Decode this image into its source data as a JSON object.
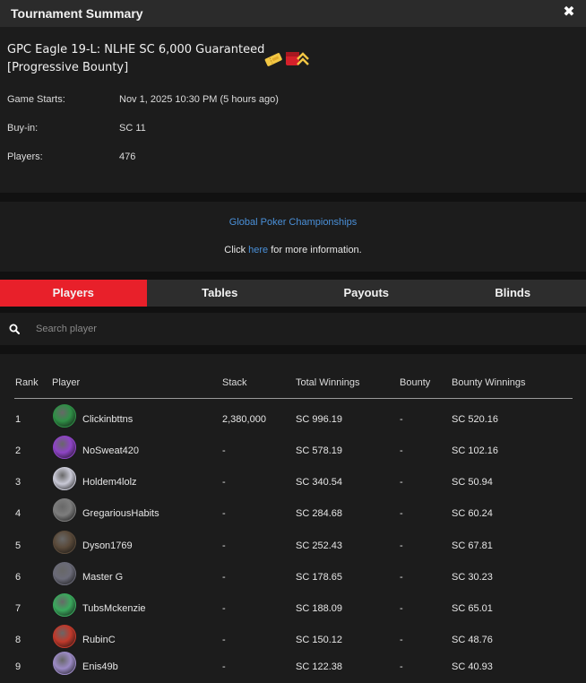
{
  "window": {
    "title": "Tournament Summary",
    "close_icon": "close-icon"
  },
  "tournament": {
    "name": "GPC Eagle 19-L: NLHE SC 6,000 Guaranteed [Progressive Bounty]",
    "icons": [
      "ticket-icon",
      "progressive-bounty-icon"
    ],
    "details": [
      {
        "label": "Game Starts:",
        "value": "Nov 1, 2025 10:30 PM (5 hours ago)"
      },
      {
        "label": "Buy-in:",
        "value": "SC 11"
      },
      {
        "label": "Players:",
        "value": "476"
      }
    ]
  },
  "promo": {
    "series_link": "Global Poker Championships",
    "prefix": "Click",
    "link": "here",
    "suffix": "for more information."
  },
  "tabs": [
    {
      "label": "Players",
      "active": true
    },
    {
      "label": "Tables",
      "active": false
    },
    {
      "label": "Payouts",
      "active": false
    },
    {
      "label": "Blinds",
      "active": false
    }
  ],
  "search": {
    "placeholder": "Search player",
    "icon": "search-icon"
  },
  "players_table": {
    "headers": {
      "rank": "Rank",
      "player": "Player",
      "stack": "Stack",
      "total": "Total Winnings",
      "bounty": "Bounty",
      "bounty_winnings": "Bounty Winnings"
    },
    "rows": [
      {
        "rank": "1",
        "player": "Clickinbttns",
        "stack": "2,380,000",
        "total": "SC 996.19",
        "bounty": "-",
        "bounty_winnings": "SC 520.16",
        "avatar_color": "#2f8f46"
      },
      {
        "rank": "2",
        "player": "NoSweat420",
        "stack": "-",
        "total": "SC 578.19",
        "bounty": "-",
        "bounty_winnings": "SC 102.16",
        "avatar_color": "#8e44c6"
      },
      {
        "rank": "3",
        "player": "Holdem4lolz",
        "stack": "-",
        "total": "SC 340.54",
        "bounty": "-",
        "bounty_winnings": "SC 50.94",
        "avatar_color": "#c9c9d6"
      },
      {
        "rank": "4",
        "player": "GregariousHabits",
        "stack": "-",
        "total": "SC 284.68",
        "bounty": "-",
        "bounty_winnings": "SC 60.24",
        "avatar_color": "#7d7d7d"
      },
      {
        "rank": "5",
        "player": "Dyson1769",
        "stack": "-",
        "total": "SC 252.43",
        "bounty": "-",
        "bounty_winnings": "SC 67.81",
        "avatar_color": "#5a4a3a"
      },
      {
        "rank": "6",
        "player": "Master G",
        "stack": "-",
        "total": "SC 178.65",
        "bounty": "-",
        "bounty_winnings": "SC 30.23",
        "avatar_color": "#6b6b78"
      },
      {
        "rank": "7",
        "player": "TubsMckenzie",
        "stack": "-",
        "total": "SC 188.09",
        "bounty": "-",
        "bounty_winnings": "SC 65.01",
        "avatar_color": "#3aa85c"
      },
      {
        "rank": "8",
        "player": "RubinC",
        "stack": "-",
        "total": "SC 150.12",
        "bounty": "-",
        "bounty_winnings": "SC 48.76",
        "avatar_color": "#c0392b"
      },
      {
        "rank": "9",
        "player": "Enis49b",
        "stack": "-",
        "total": "SC 122.38",
        "bounty": "-",
        "bounty_winnings": "SC 40.93",
        "avatar_color": "#9b8ac4"
      }
    ]
  },
  "colors": {
    "accent": "#e8202a",
    "link": "#4a90d9",
    "panel": "#1c1c1c",
    "background": "#111111"
  }
}
